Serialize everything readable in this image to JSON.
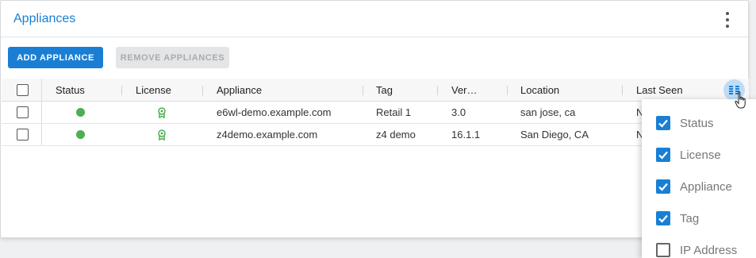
{
  "card": {
    "title": "Appliances"
  },
  "toolbar": {
    "add_label": "ADD APPLIANCE",
    "remove_label": "REMOVE APPLIANCES"
  },
  "table": {
    "headers": [
      "Status",
      "License",
      "Appliance",
      "Tag",
      "Ver…",
      "Location",
      "Last Seen"
    ],
    "rows": [
      {
        "status": "online",
        "license": "licensed",
        "appliance": "e6wl-demo.example.com",
        "tag": "Retail 1",
        "version": "3.0",
        "location": "san jose, ca",
        "last_seen": "N"
      },
      {
        "status": "online",
        "license": "licensed",
        "appliance": "z4demo.example.com",
        "tag": "z4 demo",
        "version": "16.1.1",
        "location": "San Diego, CA",
        "last_seen": "N"
      }
    ]
  },
  "column_menu": {
    "items": [
      {
        "label": "Status",
        "checked": true
      },
      {
        "label": "License",
        "checked": true
      },
      {
        "label": "Appliance",
        "checked": true
      },
      {
        "label": "Tag",
        "checked": true
      },
      {
        "label": "IP Address",
        "checked": false
      }
    ]
  },
  "colors": {
    "accent": "#1a7fd4",
    "status_online": "#4caf50",
    "license_icon": "#4caf50"
  },
  "icons": {
    "menu": "kebab-icon",
    "columns": "columns-icon",
    "license": "license-icon",
    "cursor": "hand-pointer-icon"
  }
}
